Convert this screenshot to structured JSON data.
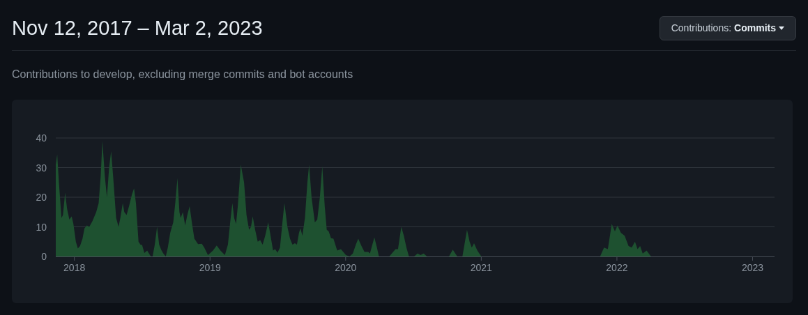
{
  "header": {
    "title": "Nov 12, 2017 – Mar 2, 2023"
  },
  "filter_button": {
    "label": "Contributions:",
    "value": "Commits"
  },
  "description": "Contributions to develop, excluding merge commits and bot accounts",
  "chart": {
    "chart_data": {
      "type": "area",
      "grid": true,
      "xlim": [
        2017.863,
        2023.162
      ],
      "ylim": [
        0,
        40
      ],
      "xticks": [
        2018,
        2019,
        2020,
        2021,
        2022,
        2023
      ],
      "yticks": [
        0,
        10,
        20,
        30,
        40
      ],
      "x": [
        2017.863,
        2017.874,
        2017.886,
        2017.905,
        2017.916,
        2017.932,
        2017.947,
        2017.963,
        2017.98,
        2017.993,
        2018.011,
        2018.026,
        2018.042,
        2018.06,
        2018.075,
        2018.092,
        2018.11,
        2018.134,
        2018.161,
        2018.179,
        2018.194,
        2018.207,
        2018.225,
        2018.24,
        2018.256,
        2018.271,
        2018.286,
        2018.308,
        2018.326,
        2018.339,
        2018.357,
        2018.368,
        2018.385,
        2018.403,
        2018.425,
        2018.44,
        2018.454,
        2018.473,
        2018.487,
        2018.5,
        2018.516,
        2018.537,
        2018.564,
        2018.577,
        2018.593,
        2018.61,
        2018.625,
        2018.641,
        2018.656,
        2018.674,
        2018.689,
        2018.707,
        2018.729,
        2018.744,
        2018.76,
        2018.775,
        2018.784,
        2018.8,
        2018.817,
        2018.833,
        2018.85,
        2018.868,
        2018.885,
        2018.912,
        2018.94,
        2018.958,
        2018.985,
        2019.022,
        2019.049,
        2019.077,
        2019.11,
        2019.132,
        2019.15,
        2019.165,
        2019.178,
        2019.192,
        2019.205,
        2019.227,
        2019.251,
        2019.269,
        2019.288,
        2019.302,
        2019.315,
        2019.333,
        2019.352,
        2019.37,
        2019.388,
        2019.407,
        2019.429,
        2019.443,
        2019.465,
        2019.48,
        2019.498,
        2019.516,
        2019.535,
        2019.549,
        2019.571,
        2019.59,
        2019.608,
        2019.626,
        2019.641,
        2019.656,
        2019.667,
        2019.681,
        2019.7,
        2019.718,
        2019.731,
        2019.749,
        2019.773,
        2019.791,
        2019.81,
        2019.828,
        2019.846,
        2019.861,
        2019.875,
        2019.892,
        2019.91,
        2019.938,
        2019.965,
        2020.002,
        2020.029,
        2020.053,
        2020.075,
        2020.093,
        2020.117,
        2020.139,
        2020.167,
        2020.179,
        2020.212,
        2020.231,
        2020.245,
        2020.322,
        2020.35,
        2020.368,
        2020.386,
        2020.41,
        2020.429,
        2020.448,
        2020.467,
        2020.505,
        2020.53,
        2020.552,
        2020.575,
        2020.6,
        2020.762,
        2020.79,
        2020.823,
        2020.861,
        2020.876,
        2020.895,
        2020.914,
        2020.93,
        2020.947,
        2020.971,
        2021.0,
        2021.876,
        2021.905,
        2021.933,
        2021.962,
        2021.985,
        2022.004,
        2022.029,
        2022.057,
        2022.086,
        2022.109,
        2022.133,
        2022.152,
        2022.171,
        2022.19,
        2022.219,
        2022.251,
        2023.162
      ],
      "series": [
        {
          "color": "#1e5130",
          "values": [
            31,
            34.5,
            25,
            13,
            14,
            21.5,
            16,
            12.5,
            13.5,
            11,
            5,
            2.7,
            3.5,
            6,
            9.5,
            10.5,
            10,
            12,
            15,
            18,
            27,
            39,
            27,
            20,
            30,
            35.5,
            27,
            13,
            10,
            13,
            18,
            15,
            14,
            17,
            21,
            23,
            18,
            5,
            4,
            3.8,
            1.2,
            2,
            0,
            0,
            4,
            10,
            4,
            2.2,
            1,
            0,
            3,
            8,
            11.5,
            18,
            26.5,
            15,
            13,
            15,
            10.5,
            14,
            17,
            11,
            6,
            4.2,
            4.3,
            3,
            0.5,
            2,
            3.7,
            2,
            0.5,
            4,
            12,
            18,
            13,
            11,
            17,
            31,
            25,
            14,
            9,
            10,
            13.5,
            9,
            5,
            5.5,
            4,
            7,
            11.5,
            8,
            2,
            2.5,
            1.3,
            3,
            12,
            18,
            10,
            6,
            4,
            4.5,
            4,
            8,
            9.5,
            7,
            13,
            25,
            31,
            20,
            11.5,
            12.5,
            20,
            30.5,
            17,
            9,
            8.5,
            6.2,
            6,
            2,
            2.5,
            0.5,
            0,
            1,
            4,
            6,
            3.5,
            1.5,
            1.5,
            1,
            6.5,
            3,
            0,
            0,
            1.5,
            2.5,
            2.5,
            10,
            7,
            3,
            0,
            0,
            1,
            0.5,
            1,
            0,
            0,
            2.3,
            0,
            0,
            4,
            9,
            5,
            3,
            4.5,
            2,
            0,
            0,
            3,
            2.5,
            11,
            8.5,
            10.5,
            8,
            7,
            3.5,
            3,
            5,
            2.5,
            3.5,
            1,
            2,
            0,
            0
          ]
        }
      ]
    }
  }
}
